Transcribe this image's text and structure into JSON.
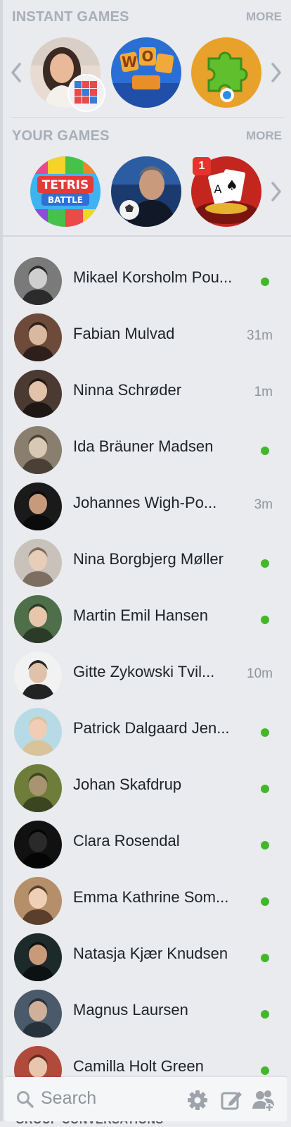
{
  "instant_games": {
    "title": "INSTANT GAMES",
    "more_label": "MORE",
    "items": [
      {
        "name": "person-photo-game"
      },
      {
        "name": "words-game"
      },
      {
        "name": "puzzle-game"
      }
    ]
  },
  "your_games": {
    "title": "YOUR GAMES",
    "more_label": "MORE",
    "items": [
      {
        "name": "tetris-battle-game",
        "label": "TETRIS BATTLE"
      },
      {
        "name": "football-game"
      },
      {
        "name": "poker-game",
        "badge": "1"
      }
    ]
  },
  "contacts": [
    {
      "name": "Mikael Korsholm Pou...",
      "status": "online",
      "time": ""
    },
    {
      "name": "Fabian Mulvad",
      "status": "",
      "time": "31m"
    },
    {
      "name": "Ninna Schrøder",
      "status": "",
      "time": "1m"
    },
    {
      "name": "Ida Bräuner Madsen",
      "status": "online",
      "time": ""
    },
    {
      "name": "Johannes Wigh-Po...",
      "status": "",
      "time": "3m"
    },
    {
      "name": "Nina Borgbjerg Møller",
      "status": "online",
      "time": ""
    },
    {
      "name": "Martin Emil Hansen",
      "status": "online",
      "time": ""
    },
    {
      "name": "Gitte Zykowski Tvil...",
      "status": "",
      "time": "10m"
    },
    {
      "name": "Patrick Dalgaard Jen...",
      "status": "online",
      "time": ""
    },
    {
      "name": "Johan Skafdrup",
      "status": "online",
      "time": ""
    },
    {
      "name": "Clara Rosendal",
      "status": "online",
      "time": ""
    },
    {
      "name": "Emma Kathrine Som...",
      "status": "online",
      "time": ""
    },
    {
      "name": "Natasja Kjær Knudsen",
      "status": "online",
      "time": ""
    },
    {
      "name": "Magnus Laursen",
      "status": "online",
      "time": ""
    },
    {
      "name": "Camilla Holt Green",
      "status": "online",
      "time": ""
    }
  ],
  "bottom_bar": {
    "search_placeholder": "Search",
    "icons": [
      "search-icon",
      "gear-icon",
      "compose-icon",
      "new-group-icon"
    ]
  },
  "group_conversations_label": "GROUP CONVERSATIONS",
  "colors": {
    "background": "#e9ebee",
    "section_title": "#a8aeb9",
    "online": "#42b72a",
    "badge": "#e3352e",
    "muted_text": "#90949c"
  }
}
